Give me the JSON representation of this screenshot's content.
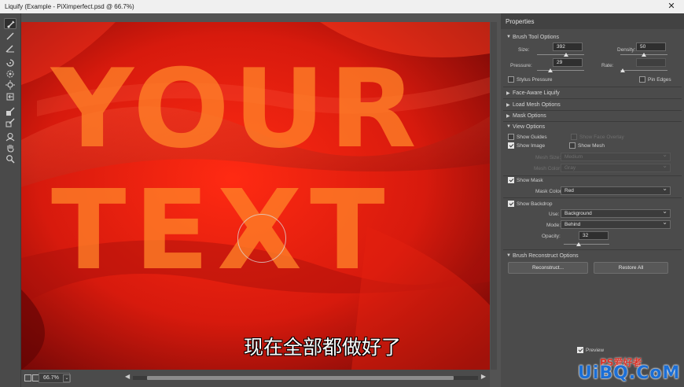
{
  "window": {
    "title": "Liquify (Example - PiXimperfect.psd @ 66.7%)",
    "close_glyph": "✕"
  },
  "toolbar": {
    "tools": [
      {
        "name": "forward-warp-tool",
        "active": true
      },
      {
        "name": "reconstruct-tool"
      },
      {
        "name": "smooth-tool"
      },
      {
        "name": "twirl-clockwise-tool"
      },
      {
        "name": "pucker-tool"
      },
      {
        "name": "bloat-tool"
      },
      {
        "name": "push-left-tool"
      },
      {
        "name": "freeze-mask-tool"
      },
      {
        "name": "thaw-mask-tool"
      },
      {
        "name": "face-tool"
      },
      {
        "name": "hand-tool"
      },
      {
        "name": "zoom-tool"
      }
    ]
  },
  "canvas": {
    "word1": "YOUR",
    "word2": "TEXT",
    "subtitle": "现在全部都做好了"
  },
  "status": {
    "zoom": "66.7%",
    "zoom_arrow": "⌄",
    "scroll_left": "◀",
    "scroll_right": "▶"
  },
  "panel": {
    "title": "Properties",
    "brush_tool_options": {
      "label": "Brush Tool Options",
      "size_label": "Size:",
      "size_value": "392",
      "size_level": 0.62,
      "density_label": "Density:",
      "density_value": "50",
      "density_level": 0.5,
      "pressure_label": "Pressure:",
      "pressure_value": "29",
      "pressure_level": 0.29,
      "rate_label": "Rate:",
      "rate_value": "",
      "rate_level": 0.0,
      "stylus_pressure": "Stylus Pressure",
      "pin_edges": "Pin Edges"
    },
    "face_aware": "Face-Aware Liquify",
    "load_mesh": "Load Mesh Options",
    "mask_options": "Mask Options",
    "view_options": {
      "label": "View Options",
      "show_guides": "Show Guides",
      "show_face_overlay": "Show Face Overlay",
      "show_image": "Show Image",
      "show_mesh": "Show Mesh",
      "mesh_size_label": "Mesh Size:",
      "mesh_size_value": "Medium",
      "mesh_color_label": "Mesh Color:",
      "mesh_color_value": "Gray",
      "show_mask": "Show Mask",
      "mask_color_label": "Mask Color:",
      "mask_color_value": "Red",
      "show_backdrop": "Show Backdrop",
      "use_label": "Use:",
      "use_value": "Background",
      "mode_label": "Mode:",
      "mode_value": "Behind",
      "opacity_label": "Opacity:",
      "opacity_value": "32",
      "opacity_level": 0.32
    },
    "brush_reconstruct": {
      "label": "Brush Reconstruct Options",
      "reconstruct_button": "Reconstruct...",
      "restore_all_button": "Restore All"
    },
    "preview": "Preview"
  },
  "watermark": {
    "ps_text": "PS爱好者",
    "url": "UiBQ.CoM"
  },
  "colors": {
    "panel_bg": "#4b4b4b",
    "canvas_red": "#d61f10",
    "text_orange": "#ff8228",
    "watermark_blue": "#1c6fd6"
  }
}
